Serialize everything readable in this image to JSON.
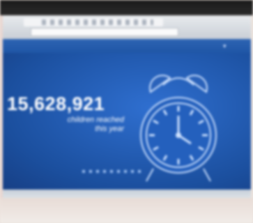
{
  "banner": {
    "count": "15,628,921",
    "caption_line1": "children reached",
    "caption_line2": "this year"
  },
  "icons": {
    "clock": "alarm-clock-icon",
    "nav": "chevron-down-icon"
  },
  "colors": {
    "screen_blue": "#1f56a6",
    "clock_outline": "#cfe2ff",
    "text": "#ffffff"
  }
}
